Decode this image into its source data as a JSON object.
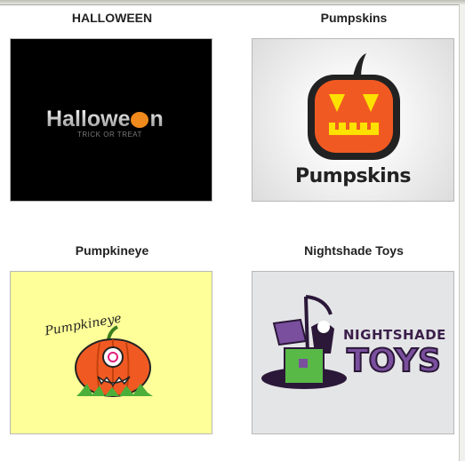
{
  "cards": [
    {
      "title": "HALLOWEEN",
      "logo_text": "Hallowe",
      "logo_text_end": "n",
      "logo_subtext": "TRICK OR TREAT"
    },
    {
      "title": "Pumpskins",
      "logo_text": "Pumpskins"
    },
    {
      "title": "Pumpkineye",
      "logo_text": "Pumpkineye"
    },
    {
      "title": "Nightshade Toys",
      "logo_text_1": "NIGHTSHADE",
      "logo_text_2": "TOYS"
    }
  ],
  "colors": {
    "halloween_bg": "#000000",
    "pumpkin_orange": "#f05a22",
    "pumpkineye_bg": "#ffff99",
    "nightshade_purple": "#7a4f9e",
    "nightshade_green": "#58b947"
  }
}
